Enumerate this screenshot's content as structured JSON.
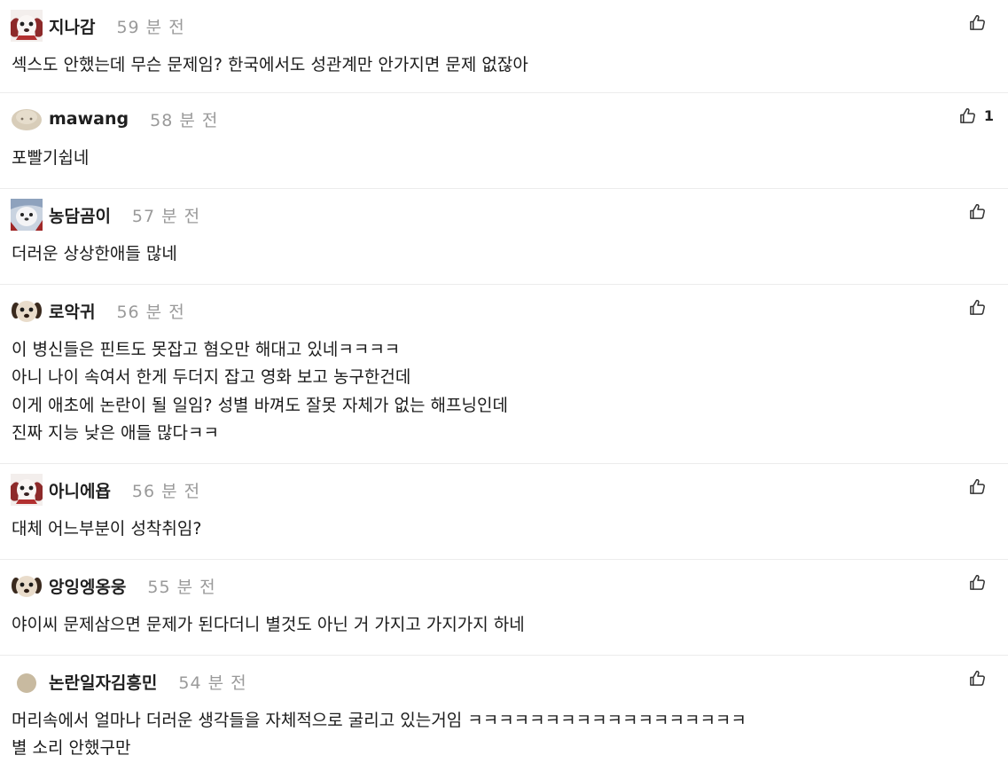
{
  "comments": [
    {
      "author": "지나감",
      "time": "59 분 전",
      "avatar": "dog-red",
      "likes": "",
      "lines": [
        "섹스도 안했는데 무슨 문제임? 한국에서도 성관계만 안가지면 문제 없잖아"
      ]
    },
    {
      "author": "mawang",
      "time": "58 분 전",
      "avatar": "blob",
      "likes": "1",
      "lines": [
        "포빨기쉽네"
      ]
    },
    {
      "author": "농담곰이",
      "time": "57 분 전",
      "avatar": "bear-blue",
      "likes": "",
      "lines": [
        "더러운 상상한애들 많네"
      ]
    },
    {
      "author": "로악귀",
      "time": "56 분 전",
      "avatar": "dog-face",
      "likes": "",
      "lines": [
        "이 병신들은 핀트도 못잡고 혐오만 해대고 있네ㅋㅋㅋㅋ",
        "아니 나이 속여서 한게 두더지 잡고 영화 보고 농구한건데",
        "이게 애초에 논란이 될 일임? 성별 바껴도 잘못 자체가 없는 해프닝인데",
        "진짜 지능 낮은 애들 많다ㅋㅋ"
      ]
    },
    {
      "author": "아니에욥",
      "time": "56 분 전",
      "avatar": "dog-red",
      "likes": "",
      "lines": [
        "대체 어느부분이 성착취임?"
      ]
    },
    {
      "author": "앙잉엥옹웅",
      "time": "55 분 전",
      "avatar": "dog-face",
      "likes": "",
      "lines": [
        "야이씨 문제삼으면 문제가 된다더니 별것도 아닌 거 가지고 가지가지 하네"
      ]
    },
    {
      "author": "논란일자김흥민",
      "time": "54 분 전",
      "avatar": "circle",
      "likes": "",
      "lines": [
        "머리속에서 얼마나 더러운 생각들을 자체적으로 굴리고 있는거임 ㅋㅋㅋㅋㅋㅋㅋㅋㅋㅋㅋㅋㅋㅋㅋㅋㅋㅋ",
        "별 소리 안했구만"
      ]
    }
  ],
  "like_icon": "thumbs-up-icon"
}
